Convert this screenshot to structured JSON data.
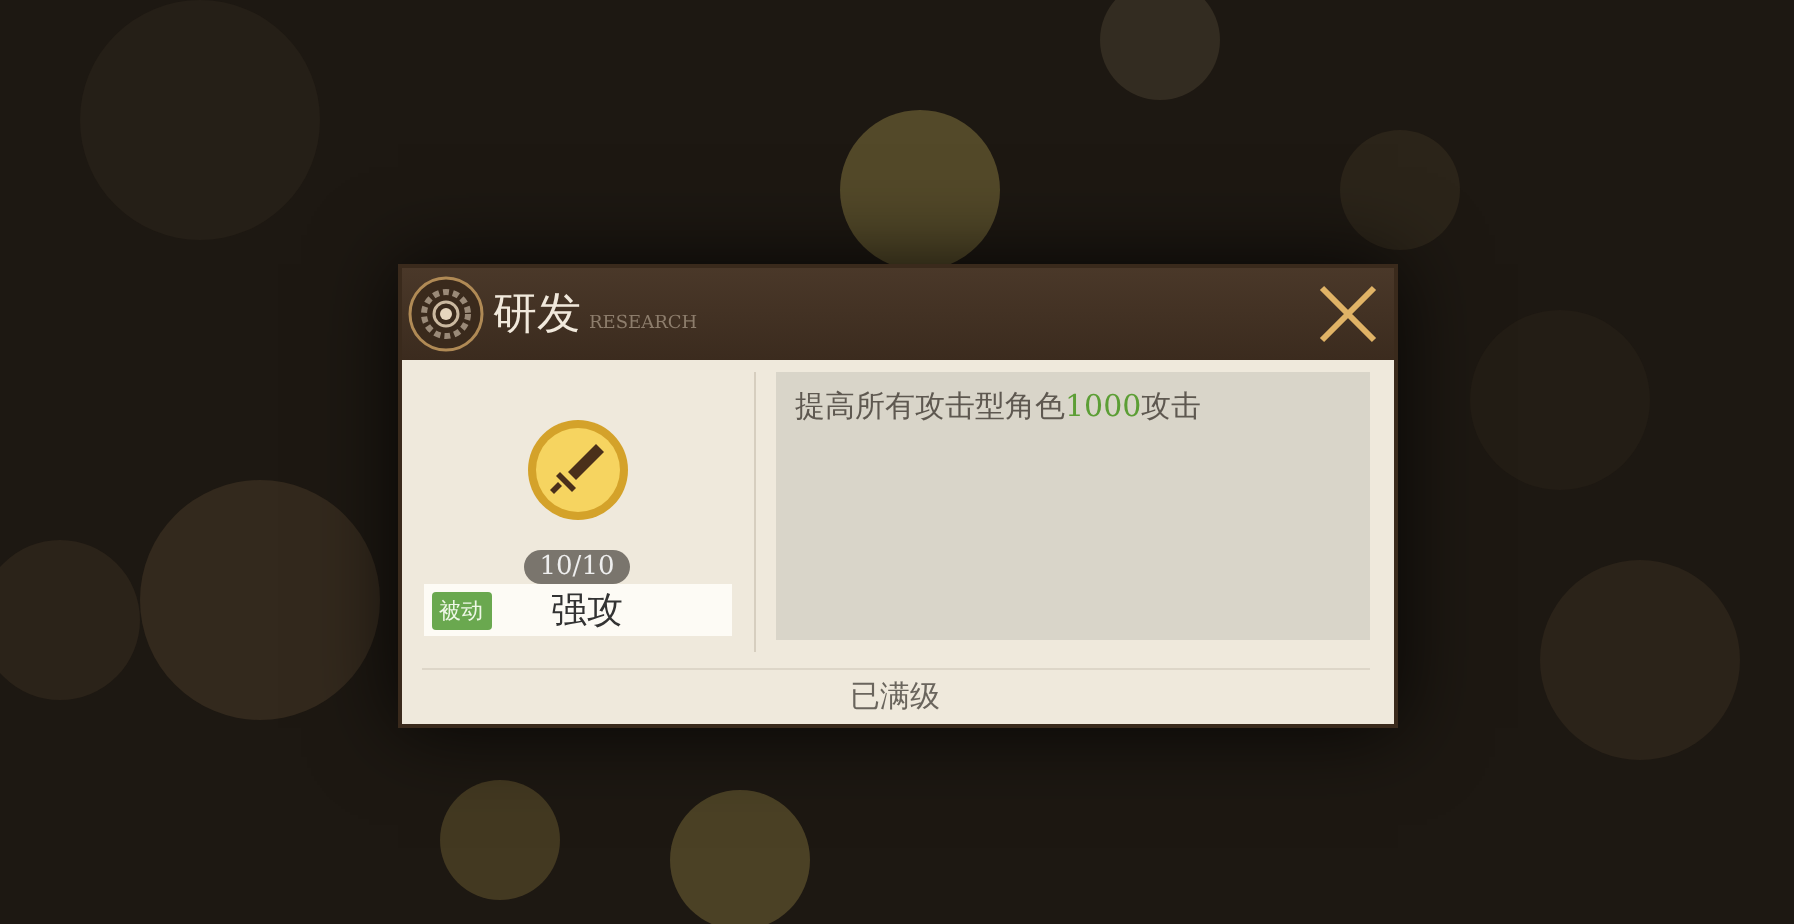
{
  "dialog": {
    "title": "研发",
    "subtitle": "RESEARCH",
    "skill": {
      "level": "10/10",
      "tag": "被动",
      "name": "强攻"
    },
    "description": [
      {
        "text": "提高所有攻击型角色",
        "highlight": false
      },
      {
        "text": "1000",
        "highlight": true
      },
      {
        "text": "攻击",
        "highlight": false
      }
    ],
    "status": "已满级"
  }
}
